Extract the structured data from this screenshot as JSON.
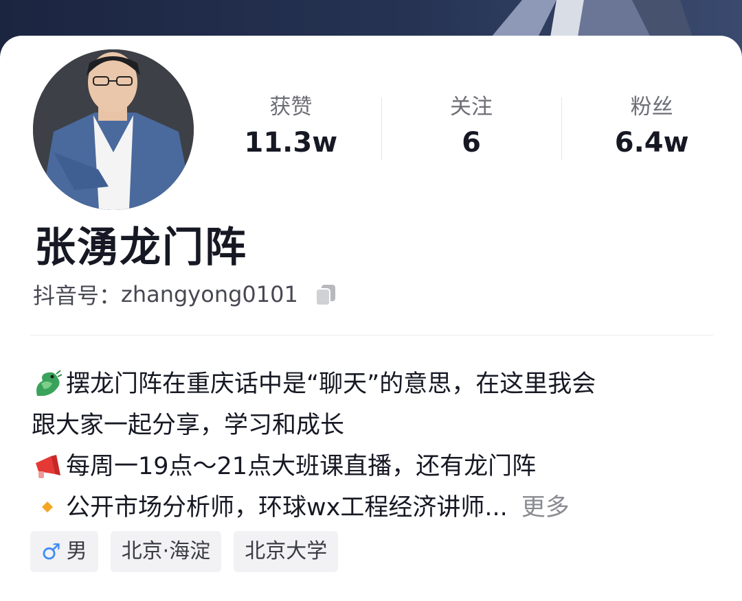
{
  "profile": {
    "name": "张湧龙门阵",
    "account_label": "抖音号：",
    "account_id": "zhangyong0101"
  },
  "stats": [
    {
      "label": "获赞",
      "value": "11.3w"
    },
    {
      "label": "关注",
      "value": "6"
    },
    {
      "label": "粉丝",
      "value": "6.4w"
    }
  ],
  "bio": {
    "line1": "摆龙门阵在重庆话中是“聊天”的意思，在这里我会",
    "line2": "跟大家一起分享，学习和成长",
    "line3": "每周一19点～21点大班课直播，还有龙门阵",
    "line4": "公开市场分析师，环球wx工程经济讲师...",
    "more_label": "更多"
  },
  "tags": {
    "gender": "男",
    "location": "北京·海淀",
    "school": "北京大学"
  },
  "colors": {
    "male_accent": "#3f8cf5",
    "banner": "#263353"
  }
}
